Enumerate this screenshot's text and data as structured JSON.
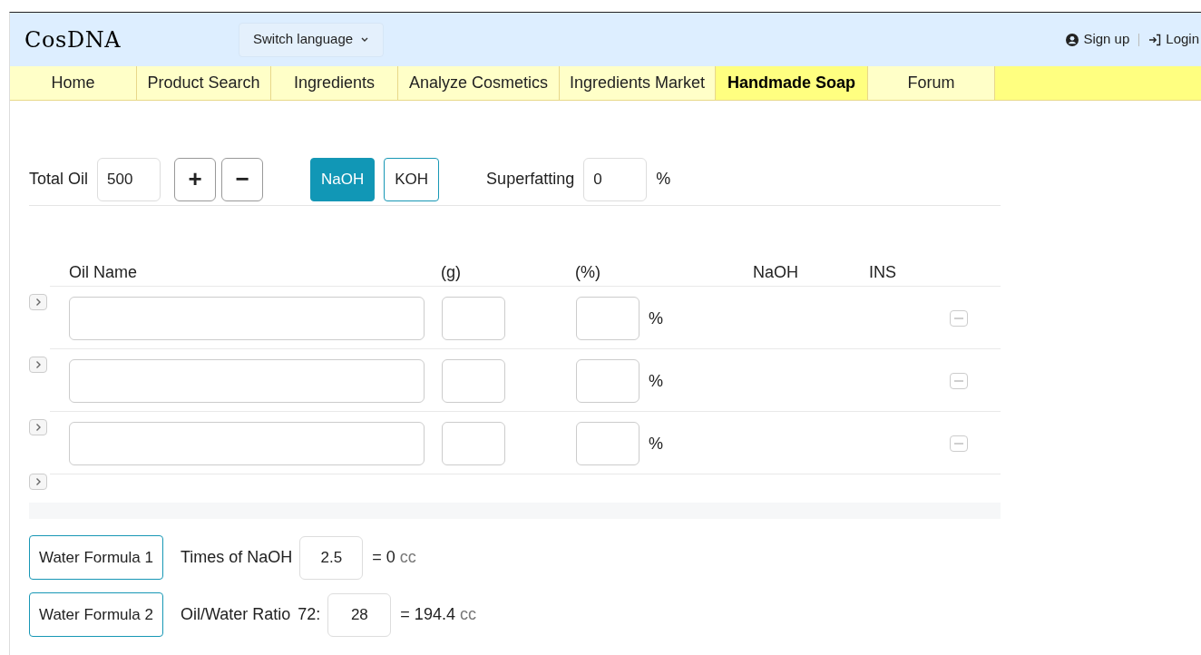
{
  "header": {
    "logo": "CosDNA",
    "language_button": "Switch language",
    "links": [
      {
        "kind": "signup",
        "label": "Sign up"
      },
      {
        "kind": "login",
        "label": "Login"
      }
    ]
  },
  "nav": [
    {
      "label": "Home",
      "selected": false
    },
    {
      "label": "Product Search",
      "selected": false
    },
    {
      "label": "Ingredients",
      "selected": false
    },
    {
      "label": "Analyze Cosmetics",
      "selected": false
    },
    {
      "label": "Ingredients Market",
      "selected": false
    },
    {
      "label": "Handmade Soap",
      "selected": true
    },
    {
      "label": "Forum",
      "selected": false
    }
  ],
  "controls": {
    "total_oil_label": "Total Oil",
    "total_oil": "500",
    "plus": "+",
    "minus": "−",
    "alkali": [
      {
        "label": "NaOH",
        "selected": true
      },
      {
        "label": "KOH",
        "selected": false
      }
    ],
    "superfatting_label": "Superfatting",
    "superfatting": "0",
    "percent": "%"
  },
  "table": {
    "columns": [
      "Oil Name",
      "(g)",
      "(%)",
      "NaOH",
      "INS"
    ],
    "rows": [
      {
        "percent_unit": "%"
      },
      {
        "percent_unit": "%"
      },
      {
        "percent_unit": "%"
      }
    ]
  },
  "water": [
    {
      "button": "Water Formula 1",
      "label": "Times of NaOH",
      "value": "2.5",
      "result": "= 0",
      "unit": "cc"
    },
    {
      "button": "Water Formula 2",
      "label": "Oil/Water Ratio",
      "prefix": "72:",
      "value": "28",
      "result": "= 194.4",
      "unit": "cc"
    }
  ]
}
